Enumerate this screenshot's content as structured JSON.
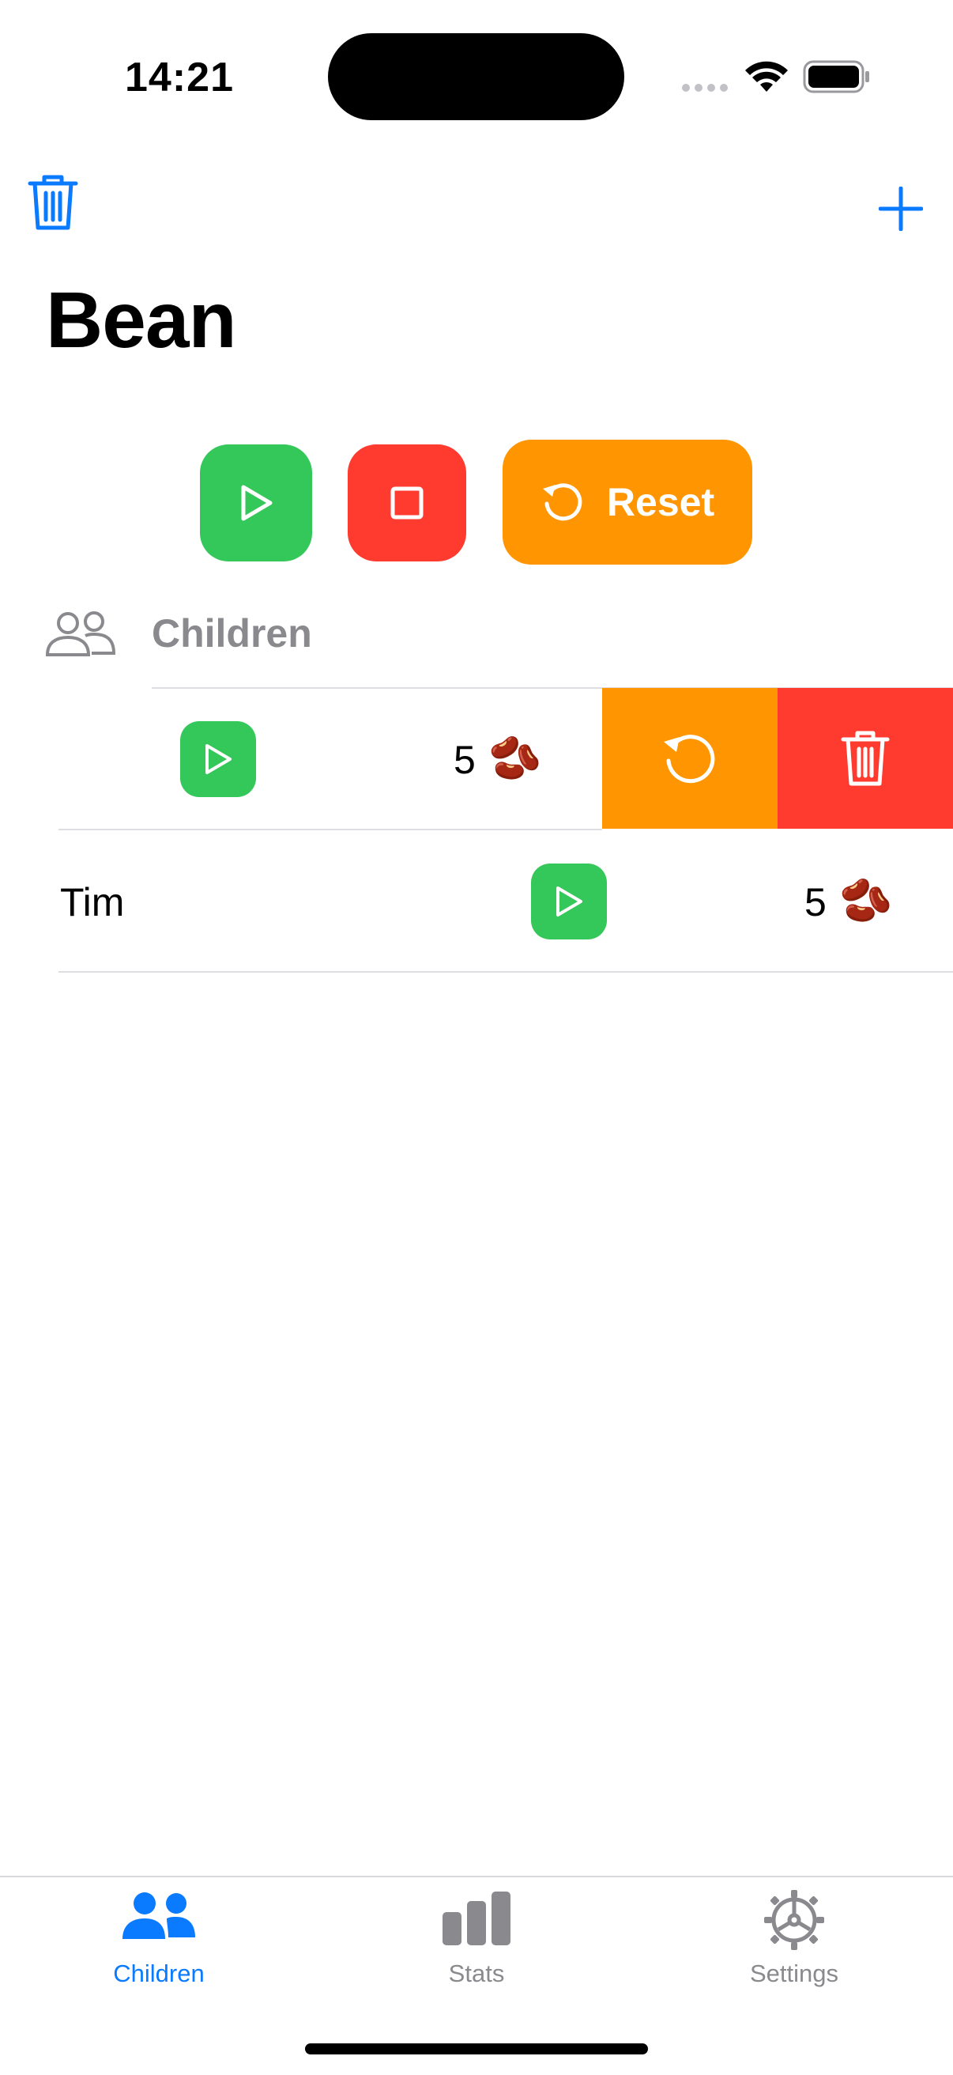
{
  "status_bar": {
    "time": "14:21"
  },
  "header": {
    "title": "Bean"
  },
  "controls": {
    "reset_label": "Reset"
  },
  "section": {
    "label": "Children"
  },
  "rows": [
    {
      "name": "",
      "count": "5",
      "emoji": "🫘",
      "swiped": true
    },
    {
      "name": "Tim",
      "count": "5",
      "emoji": "🫘",
      "swiped": false
    }
  ],
  "tabs": [
    {
      "label": "Children",
      "icon": "people-icon",
      "selected": true
    },
    {
      "label": "Stats",
      "icon": "chart-icon",
      "selected": false
    },
    {
      "label": "Settings",
      "icon": "gear-icon",
      "selected": false
    }
  ],
  "colors": {
    "accent": "#0a7aff",
    "green": "#34c759",
    "red": "#ff3b30",
    "orange": "#ff9500",
    "gray": "#8a8a8e"
  }
}
